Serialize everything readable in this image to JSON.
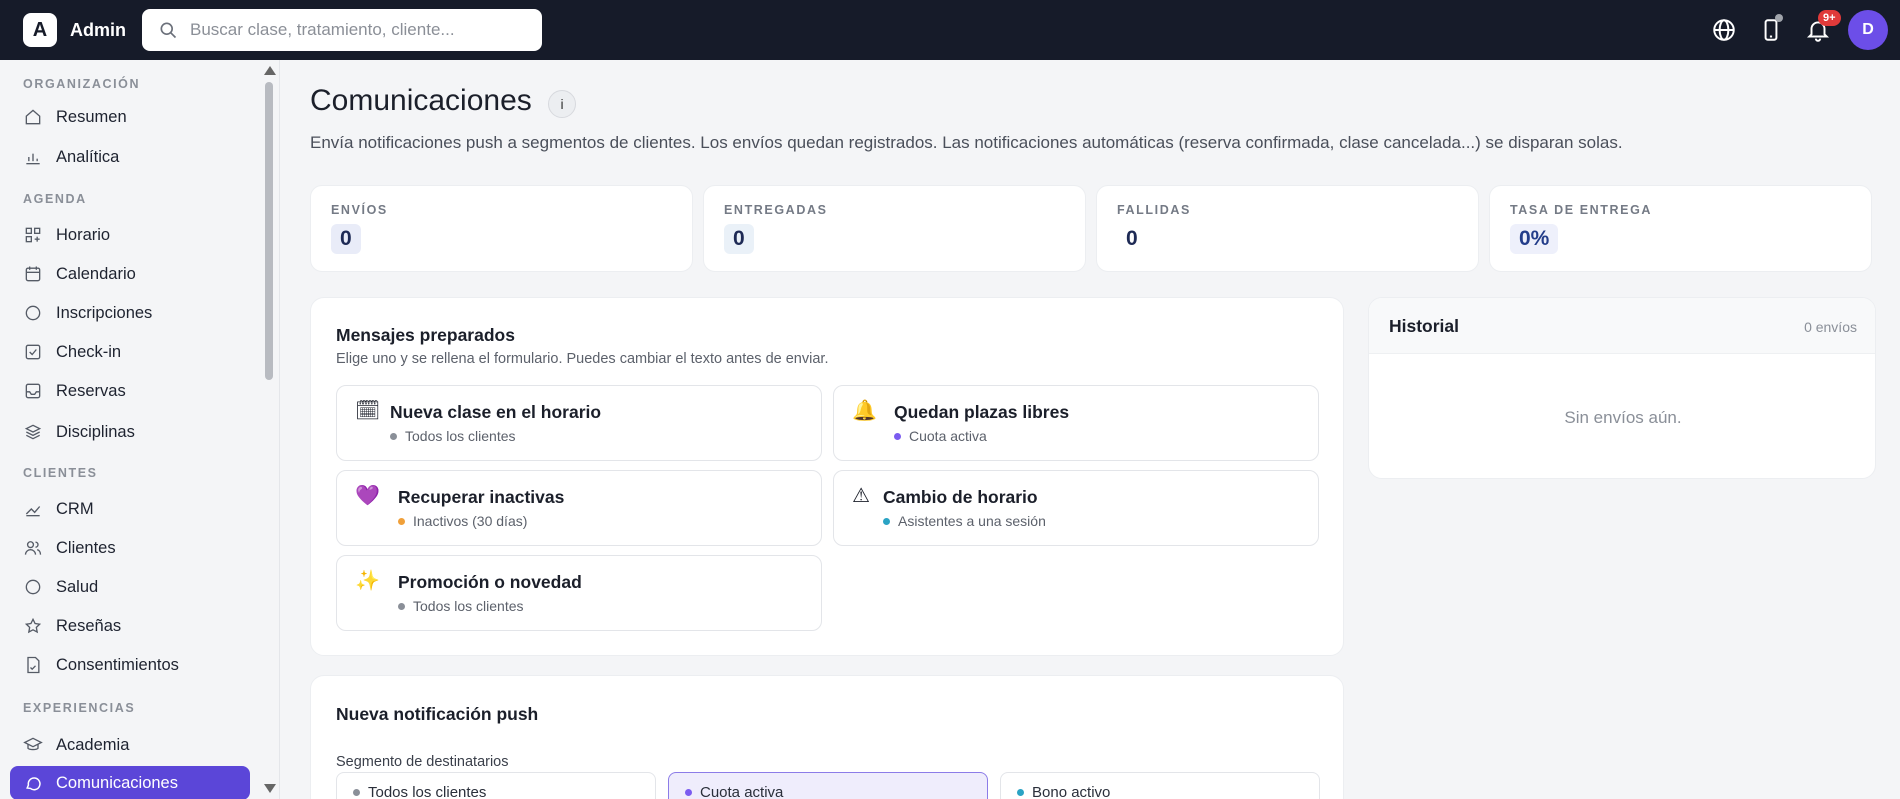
{
  "topbar": {
    "logo_letter": "A",
    "app_name": "Admin",
    "search_placeholder": "Buscar clase, tratamiento, cliente...",
    "notifications_badge": "9+",
    "avatar_initial": "D"
  },
  "sidebar": {
    "sections": [
      {
        "title": "ORGANIZACIÓN",
        "items": [
          {
            "label": "Resumen",
            "icon": "home-icon"
          },
          {
            "label": "Analítica",
            "icon": "bar-chart-icon"
          }
        ]
      },
      {
        "title": "AGENDA",
        "items": [
          {
            "label": "Horario",
            "icon": "grid-plus-icon"
          },
          {
            "label": "Calendario",
            "icon": "calendar-icon"
          },
          {
            "label": "Inscripciones",
            "icon": "circle-icon"
          },
          {
            "label": "Check-in",
            "icon": "check-square-icon"
          },
          {
            "label": "Reservas",
            "icon": "inbox-icon"
          },
          {
            "label": "Disciplinas",
            "icon": "layers-icon"
          }
        ]
      },
      {
        "title": "CLIENTES",
        "items": [
          {
            "label": "CRM",
            "icon": "trend-icon"
          },
          {
            "label": "Clientes",
            "icon": "users-icon"
          },
          {
            "label": "Salud",
            "icon": "circle-icon"
          },
          {
            "label": "Reseñas",
            "icon": "star-icon"
          },
          {
            "label": "Consentimientos",
            "icon": "document-icon"
          }
        ]
      },
      {
        "title": "EXPERIENCIAS",
        "items": [
          {
            "label": "Academia",
            "icon": "graduation-cap-icon"
          },
          {
            "label": "Comunicaciones",
            "icon": "chat-bubble-icon",
            "active": true
          }
        ]
      }
    ]
  },
  "page": {
    "title": "Comunicaciones",
    "info_icon": "i",
    "subtitle": "Envía notificaciones push a segmentos de clientes. Los envíos quedan registrados. Las notificaciones automáticas (reserva confirmada, clase cancelada...) se disparan solas."
  },
  "stats": [
    {
      "label": "ENVÍOS",
      "value": "0"
    },
    {
      "label": "ENTREGADAS",
      "value": "0"
    },
    {
      "label": "FALLIDAS",
      "value": "0"
    },
    {
      "label": "TASA DE ENTREGA",
      "value": "0%"
    }
  ],
  "templates": {
    "title": "Mensajes preparados",
    "subtitle": "Elige uno y se rellena el formulario. Puedes cambiar el texto antes de enviar.",
    "items": [
      {
        "emoji": "🗓",
        "title": "Nueva clase en el horario",
        "segment": "Todos los clientes",
        "dot_color": "#8a8f98"
      },
      {
        "emoji": "🔔",
        "title": "Quedan plazas libres",
        "segment": "Cuota activa",
        "dot_color": "#7b5cf0"
      },
      {
        "emoji": "💜",
        "title": "Recuperar inactivas",
        "segment": "Inactivos (30 días)",
        "dot_color": "#f0a03a"
      },
      {
        "emoji": "⚠",
        "title": "Cambio de horario",
        "segment": "Asistentes a una sesión",
        "dot_color": "#2aa3c4"
      },
      {
        "emoji": "✨",
        "title": "Promoción o novedad",
        "segment": "Todos los clientes",
        "dot_color": "#8a8f98"
      }
    ]
  },
  "history": {
    "title": "Historial",
    "count": "0 envíos",
    "empty": "Sin envíos aún."
  },
  "push_form": {
    "title": "Nueva notificación push",
    "segment_label": "Segmento de destinatarios",
    "segments": [
      {
        "label": "Todos los clientes",
        "dot_color": "#8a8f98"
      },
      {
        "label": "Cuota activa",
        "dot_color": "#7b5cf0",
        "selected": true
      },
      {
        "label": "Bono activo",
        "dot_color": "#2aa3c4"
      }
    ]
  },
  "colors": {
    "topbar_bg": "#161b29",
    "accent": "#5b46d8",
    "avatar": "#6c4ee8",
    "badge": "#e03a3a"
  }
}
